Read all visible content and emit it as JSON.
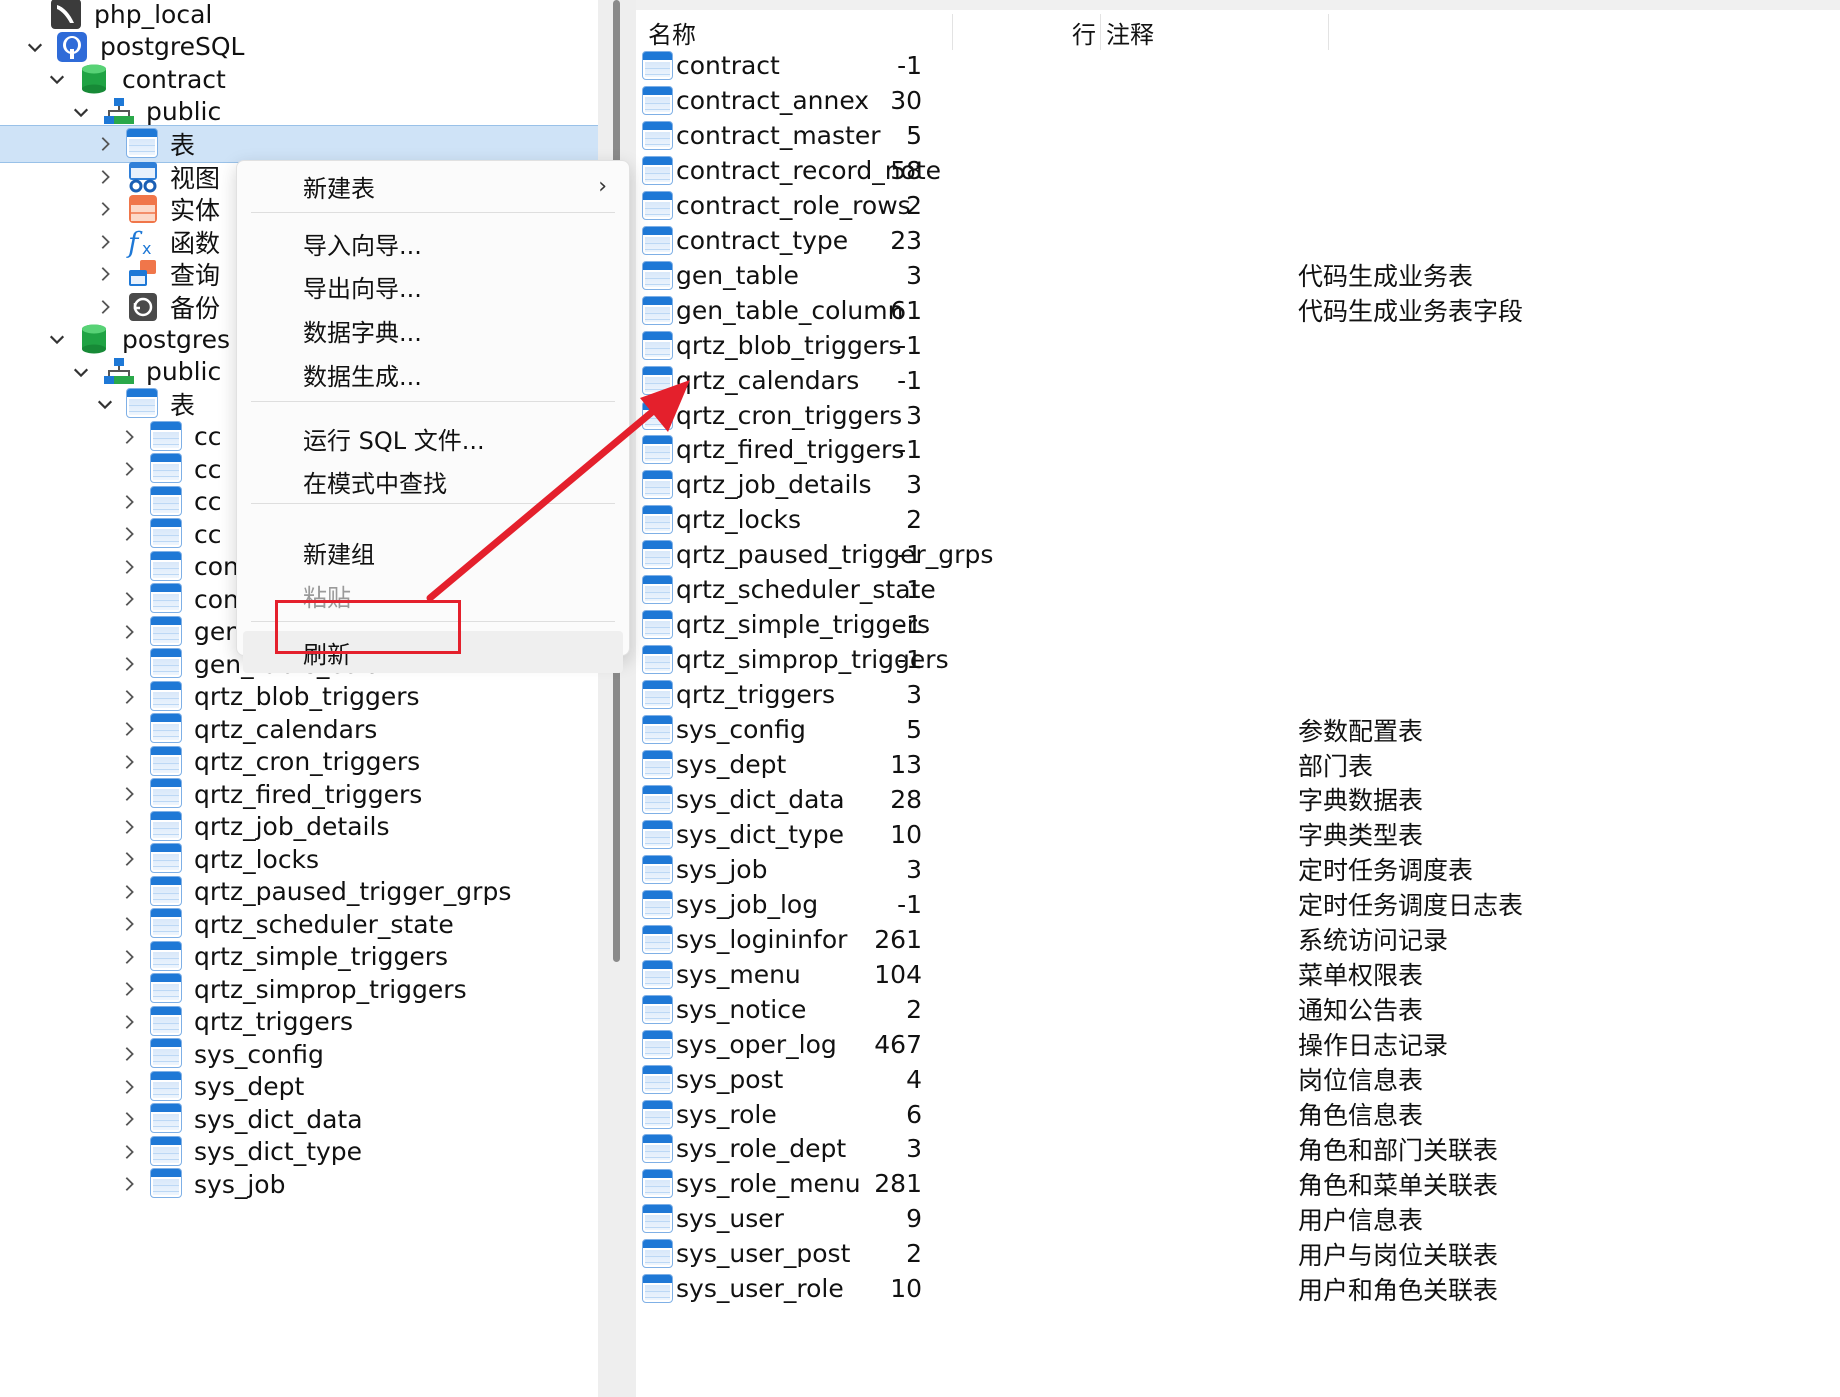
{
  "tree": {
    "connections": [
      {
        "label": "php_local"
      },
      {
        "label": "postgreSQL"
      }
    ],
    "contract_db": {
      "label": "contract",
      "schema": "public"
    },
    "contract_schema_items": [
      "表",
      "视图",
      "实体",
      "函数",
      "查询",
      "备份"
    ],
    "postgres_db": {
      "label": "postgres",
      "schema": "public",
      "tables_label": "表"
    },
    "partial_tables": [
      "cc",
      "cc",
      "cc",
      "cc"
    ],
    "tables": [
      "contract_role_rows",
      "contract_type",
      "gen_table",
      "gen_table_column",
      "qrtz_blob_triggers",
      "qrtz_calendars",
      "qrtz_cron_triggers",
      "qrtz_fired_triggers",
      "qrtz_job_details",
      "qrtz_locks",
      "qrtz_paused_trigger_grps",
      "qrtz_scheduler_state",
      "qrtz_simple_triggers",
      "qrtz_simprop_triggers",
      "qrtz_triggers",
      "sys_config",
      "sys_dept",
      "sys_dict_data",
      "sys_dict_type",
      "sys_job"
    ]
  },
  "context_menu": {
    "items": [
      {
        "label": "新建表",
        "submenu": true
      },
      {
        "label": "导入向导..."
      },
      {
        "label": "导出向导..."
      },
      {
        "label": "数据字典..."
      },
      {
        "label": "数据生成..."
      },
      {
        "label": "运行 SQL 文件..."
      },
      {
        "label": "在模式中查找"
      },
      {
        "label": "新建组"
      },
      {
        "label": "粘贴",
        "disabled": true
      },
      {
        "label": "刷新",
        "highlighted": true
      }
    ],
    "submenu_glyph": "›"
  },
  "object_list": {
    "headers": {
      "name": "名称",
      "rows": "行",
      "comment": "注释"
    },
    "rows": [
      {
        "name": "contract",
        "rows": "-1",
        "comment": ""
      },
      {
        "name": "contract_annex",
        "rows": "30",
        "comment": ""
      },
      {
        "name": "contract_master",
        "rows": "5",
        "comment": ""
      },
      {
        "name": "contract_record_note",
        "rows": "58",
        "comment": ""
      },
      {
        "name": "contract_role_rows",
        "rows": "2",
        "comment": ""
      },
      {
        "name": "contract_type",
        "rows": "23",
        "comment": ""
      },
      {
        "name": "gen_table",
        "rows": "3",
        "comment": "代码生成业务表"
      },
      {
        "name": "gen_table_column",
        "rows": "61",
        "comment": "代码生成业务表字段"
      },
      {
        "name": "qrtz_blob_triggers",
        "rows": "-1",
        "comment": ""
      },
      {
        "name": "qrtz_calendars",
        "rows": "-1",
        "comment": ""
      },
      {
        "name": "qrtz_cron_triggers",
        "rows": "3",
        "comment": ""
      },
      {
        "name": "qrtz_fired_triggers",
        "rows": "-1",
        "comment": ""
      },
      {
        "name": "qrtz_job_details",
        "rows": "3",
        "comment": ""
      },
      {
        "name": "qrtz_locks",
        "rows": "2",
        "comment": ""
      },
      {
        "name": "qrtz_paused_trigger_grps",
        "rows": "-1",
        "comment": ""
      },
      {
        "name": "qrtz_scheduler_state",
        "rows": "1",
        "comment": ""
      },
      {
        "name": "qrtz_simple_triggers",
        "rows": "-1",
        "comment": ""
      },
      {
        "name": "qrtz_simprop_triggers",
        "rows": "-1",
        "comment": ""
      },
      {
        "name": "qrtz_triggers",
        "rows": "3",
        "comment": ""
      },
      {
        "name": "sys_config",
        "rows": "5",
        "comment": "参数配置表"
      },
      {
        "name": "sys_dept",
        "rows": "13",
        "comment": "部门表"
      },
      {
        "name": "sys_dict_data",
        "rows": "28",
        "comment": "字典数据表"
      },
      {
        "name": "sys_dict_type",
        "rows": "10",
        "comment": "字典类型表"
      },
      {
        "name": "sys_job",
        "rows": "3",
        "comment": "定时任务调度表"
      },
      {
        "name": "sys_job_log",
        "rows": "-1",
        "comment": "定时任务调度日志表"
      },
      {
        "name": "sys_logininfor",
        "rows": "261",
        "comment": "系统访问记录"
      },
      {
        "name": "sys_menu",
        "rows": "104",
        "comment": "菜单权限表"
      },
      {
        "name": "sys_notice",
        "rows": "2",
        "comment": "通知公告表"
      },
      {
        "name": "sys_oper_log",
        "rows": "467",
        "comment": "操作日志记录"
      },
      {
        "name": "sys_post",
        "rows": "4",
        "comment": "岗位信息表"
      },
      {
        "name": "sys_role",
        "rows": "6",
        "comment": "角色信息表"
      },
      {
        "name": "sys_role_dept",
        "rows": "3",
        "comment": "角色和部门关联表"
      },
      {
        "name": "sys_role_menu",
        "rows": "281",
        "comment": "角色和菜单关联表"
      },
      {
        "name": "sys_user",
        "rows": "9",
        "comment": "用户信息表"
      },
      {
        "name": "sys_user_post",
        "rows": "2",
        "comment": "用户与岗位关联表"
      },
      {
        "name": "sys_user_role",
        "rows": "10",
        "comment": "用户和角色关联表"
      }
    ]
  },
  "annotation": {
    "color": "#e4202c"
  },
  "icons": {
    "chevron_right": "chevron-right-icon",
    "chevron_down": "chevron-down-icon",
    "table": "table-icon",
    "database": "database-icon",
    "schema": "schema-icon"
  }
}
